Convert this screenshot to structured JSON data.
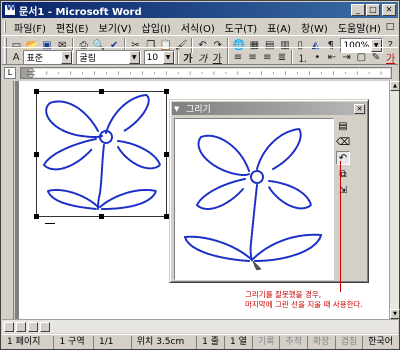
{
  "window": {
    "title": "문서1 - Microsoft Word"
  },
  "menu": {
    "items": [
      "파일(F)",
      "편집(E)",
      "보기(V)",
      "삽입(I)",
      "서식(O)",
      "도구(T)",
      "표(A)",
      "창(W)",
      "도움말(H)"
    ]
  },
  "toolbar": {
    "zoom": "100%",
    "style": "표준",
    "font": "굴림",
    "size": "10"
  },
  "ink_window": {
    "title": "그리기"
  },
  "annotation": {
    "line1": "그리기를 잘못했을 경우,",
    "line2": "마지막에 그린 선을 지울 때 사용한다."
  },
  "statusbar": {
    "page": "1 페이지",
    "section": "1 구역",
    "pages": "1/1",
    "position": "위치 3.5cm",
    "line": "1 줄",
    "col": "1 열",
    "rec": "기록",
    "trk": "추적",
    "ext": "확장",
    "ovr": "겹침",
    "lang": "한국어"
  },
  "colors": {
    "title_bar": "#0a246a",
    "ink": "#1a2ec8",
    "annotation": "#cc0000"
  }
}
